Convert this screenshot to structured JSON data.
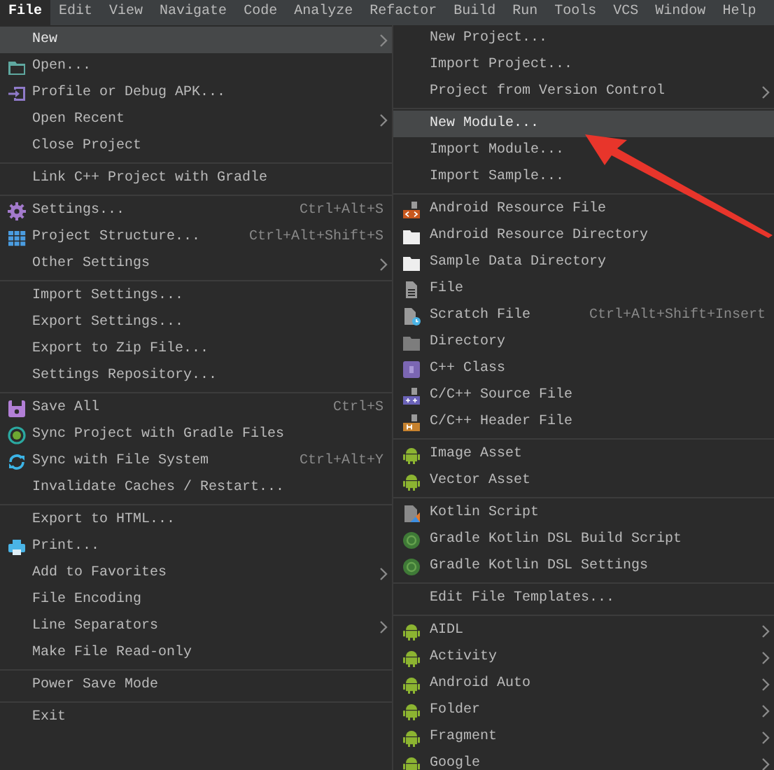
{
  "menu_bar": [
    {
      "label": "File",
      "selected": true
    },
    {
      "label": "Edit",
      "selected": false
    },
    {
      "label": "View",
      "selected": false
    },
    {
      "label": "Navigate",
      "selected": false
    },
    {
      "label": "Code",
      "selected": false
    },
    {
      "label": "Analyze",
      "selected": false
    },
    {
      "label": "Refactor",
      "selected": false
    },
    {
      "label": "Build",
      "selected": false
    },
    {
      "label": "Run",
      "selected": false
    },
    {
      "label": "Tools",
      "selected": false
    },
    {
      "label": "VCS",
      "selected": false
    },
    {
      "label": "Window",
      "selected": false
    },
    {
      "label": "Help",
      "selected": false
    }
  ],
  "file_menu": [
    [
      {
        "label": "New",
        "selected": true,
        "submenu": true
      },
      {
        "label": "Open...",
        "selected": false,
        "submenu": false,
        "kind": "folder"
      },
      {
        "label": "Profile or Debug APK...",
        "selected": false,
        "submenu": false,
        "kind": "import"
      },
      {
        "label": "Open Recent",
        "selected": false,
        "submenu": true
      },
      {
        "label": "Close Project",
        "selected": false,
        "submenu": false
      }
    ],
    [
      {
        "label": "Link C++ Project with Gradle",
        "selected": false,
        "submenu": false
      }
    ],
    [
      {
        "label": "Settings...",
        "shortcut": "Ctrl+Alt+S",
        "selected": false,
        "submenu": false,
        "kind": "gear"
      },
      {
        "label": "Project Structure...",
        "shortcut": "Ctrl+Alt+Shift+S",
        "selected": false,
        "submenu": false,
        "kind": "grid"
      },
      {
        "label": "Other Settings",
        "selected": false,
        "submenu": true
      }
    ],
    [
      {
        "label": "Import Settings...",
        "selected": false,
        "submenu": false
      },
      {
        "label": "Export Settings...",
        "selected": false,
        "submenu": false
      },
      {
        "label": "Export to Zip File...",
        "selected": false,
        "submenu": false
      },
      {
        "label": "Settings Repository...",
        "selected": false,
        "submenu": false
      }
    ],
    [
      {
        "label": "Save All",
        "shortcut": "Ctrl+S",
        "selected": false,
        "submenu": false,
        "kind": "save"
      },
      {
        "label": "Sync Project with Gradle Files",
        "selected": false,
        "submenu": false,
        "kind": "gradlesync"
      },
      {
        "label": "Sync with File System",
        "shortcut": "Ctrl+Alt+Y",
        "selected": false,
        "submenu": false,
        "kind": "sync"
      },
      {
        "label": "Invalidate Caches / Restart...",
        "selected": false,
        "submenu": false
      }
    ],
    [
      {
        "label": "Export to HTML...",
        "selected": false,
        "submenu": false
      },
      {
        "label": "Print...",
        "selected": false,
        "submenu": false,
        "kind": "printer"
      },
      {
        "label": "Add to Favorites",
        "selected": false,
        "submenu": true
      },
      {
        "label": "File Encoding",
        "selected": false,
        "submenu": false
      },
      {
        "label": "Line Separators",
        "selected": false,
        "submenu": true
      },
      {
        "label": "Make File Read-only",
        "selected": false,
        "submenu": false
      }
    ],
    [
      {
        "label": "Power Save Mode",
        "selected": false,
        "submenu": false
      }
    ],
    [
      {
        "label": "Exit",
        "selected": false,
        "submenu": false
      }
    ]
  ],
  "new_submenu": [
    [
      {
        "label": "New Project...",
        "selected": false,
        "submenu": false
      },
      {
        "label": "Import Project...",
        "selected": false,
        "submenu": false
      },
      {
        "label": "Project from Version Control",
        "selected": false,
        "submenu": true
      }
    ],
    [
      {
        "label": "New Module...",
        "selected": true,
        "submenu": false
      },
      {
        "label": "Import Module...",
        "selected": false,
        "submenu": false
      },
      {
        "label": "Import Sample...",
        "selected": false,
        "submenu": false
      }
    ],
    [
      {
        "label": "Android Resource File",
        "selected": false,
        "submenu": false,
        "kind": "resource"
      },
      {
        "label": "Android Resource Directory",
        "selected": false,
        "submenu": false,
        "kind": "whitefolder"
      },
      {
        "label": "Sample Data Directory",
        "selected": false,
        "submenu": false,
        "kind": "whitefolder"
      },
      {
        "label": "File",
        "selected": false,
        "submenu": false,
        "kind": "file"
      },
      {
        "label": "Scratch File",
        "shortcut": "Ctrl+Alt+Shift+Insert",
        "selected": false,
        "submenu": false,
        "kind": "scratch"
      },
      {
        "label": "Directory",
        "selected": false,
        "submenu": false,
        "kind": "directory"
      },
      {
        "label": "C++ Class",
        "selected": false,
        "submenu": false,
        "kind": "class"
      },
      {
        "label": "C/C++ Source File",
        "selected": false,
        "submenu": false,
        "kind": "source"
      },
      {
        "label": "C/C++ Header File",
        "selected": false,
        "submenu": false,
        "kind": "header"
      }
    ],
    [
      {
        "label": "Image Asset",
        "selected": false,
        "submenu": false,
        "kind": "android"
      },
      {
        "label": "Vector Asset",
        "selected": false,
        "submenu": false,
        "kind": "android"
      }
    ],
    [
      {
        "label": "Kotlin Script",
        "selected": false,
        "submenu": false,
        "kind": "kotlin"
      },
      {
        "label": "Gradle Kotlin DSL Build Script",
        "selected": false,
        "submenu": false,
        "kind": "gradle"
      },
      {
        "label": "Gradle Kotlin DSL Settings",
        "selected": false,
        "submenu": false,
        "kind": "gradle"
      }
    ],
    [
      {
        "label": "Edit File Templates...",
        "selected": false,
        "submenu": false
      }
    ],
    [
      {
        "label": "AIDL",
        "selected": false,
        "submenu": true,
        "kind": "android"
      },
      {
        "label": "Activity",
        "selected": false,
        "submenu": true,
        "kind": "android"
      },
      {
        "label": "Android Auto",
        "selected": false,
        "submenu": true,
        "kind": "android"
      },
      {
        "label": "Folder",
        "selected": false,
        "submenu": true,
        "kind": "android"
      },
      {
        "label": "Fragment",
        "selected": false,
        "submenu": true,
        "kind": "android"
      },
      {
        "label": "Google",
        "selected": false,
        "submenu": true,
        "kind": "android"
      }
    ]
  ]
}
